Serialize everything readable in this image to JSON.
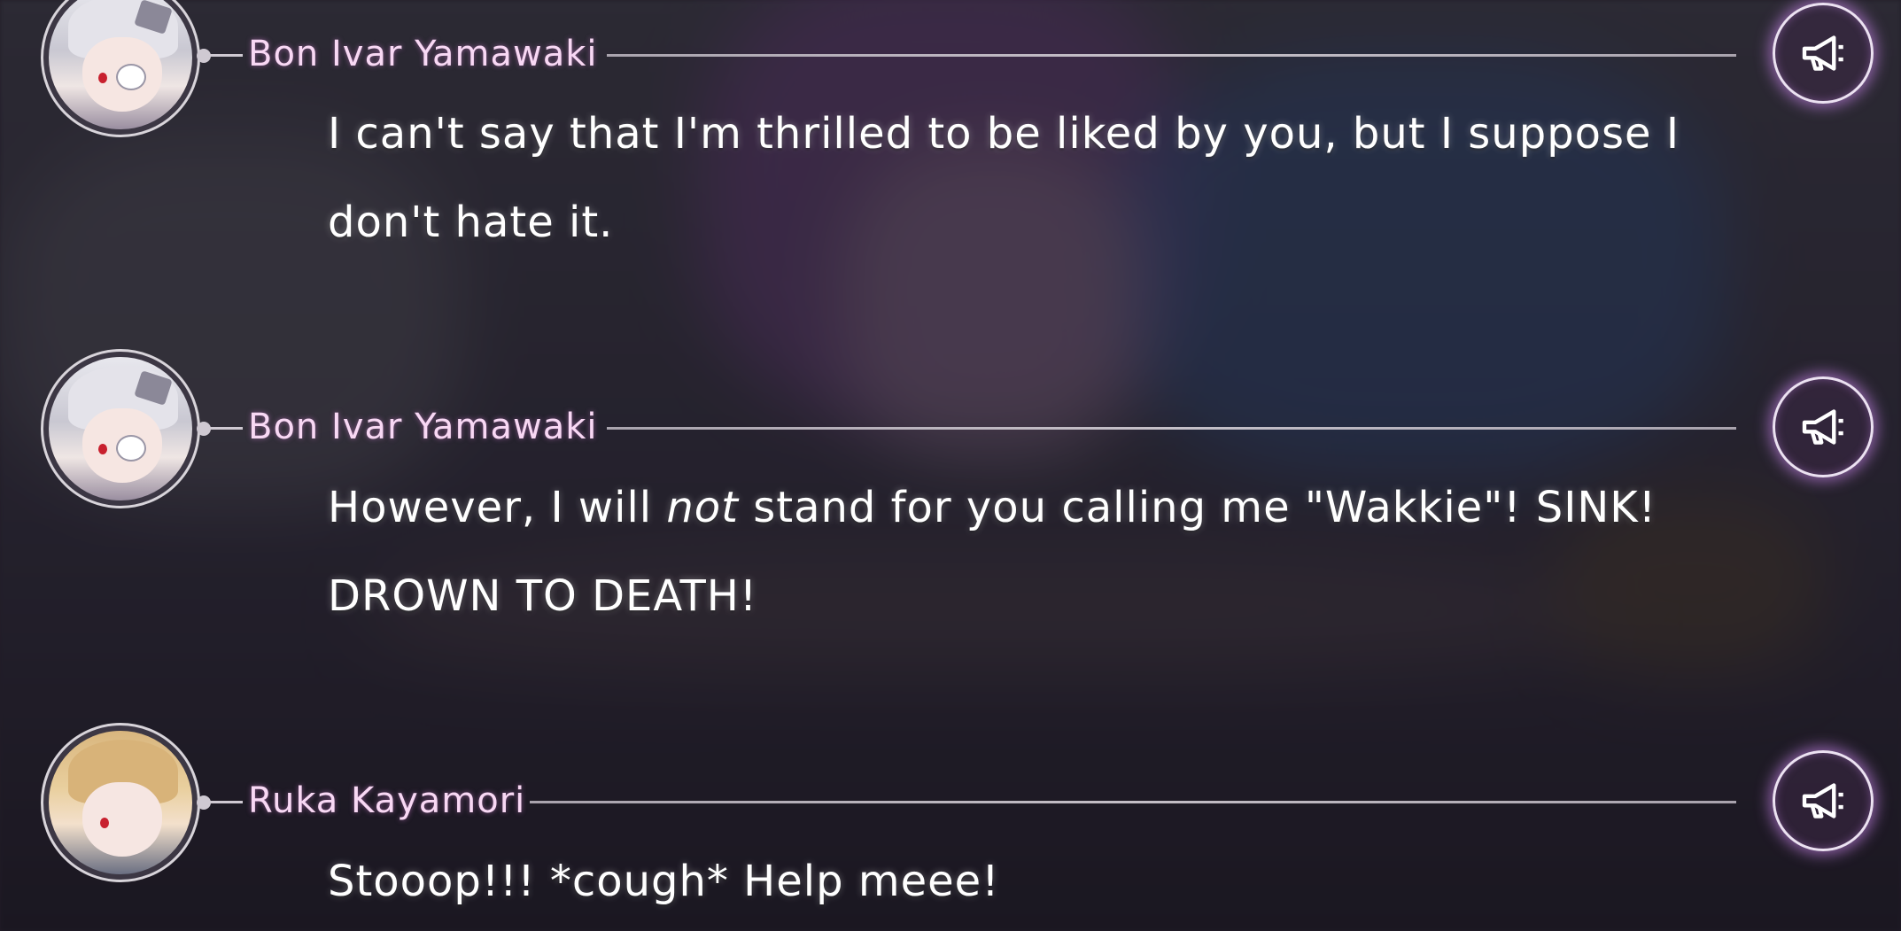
{
  "backlog": {
    "entries": [
      {
        "speaker": "Bon Ivar Yamawaki",
        "lines": [
          "I can't say that I'm thrilled to be liked by you, but I suppose I",
          "don't hate it."
        ],
        "voice_icon": "megaphone-icon"
      },
      {
        "speaker": "Bon Ivar Yamawaki",
        "line1_before": "However, I will ",
        "line1_emphasis": "not",
        "line1_after": " stand for you calling me \"Wakkie\"! SINK!",
        "line2": "DROWN TO DEATH!",
        "voice_icon": "megaphone-icon"
      },
      {
        "speaker": "Ruka Kayamori",
        "lines": [
          "Stooop!!! *cough* Help meee!"
        ],
        "voice_icon": "megaphone-icon"
      }
    ]
  },
  "colors": {
    "speaker_name": "#f8d8f4",
    "dialogue_text": "#ffffff",
    "voice_button_glow": "#c482e6"
  }
}
